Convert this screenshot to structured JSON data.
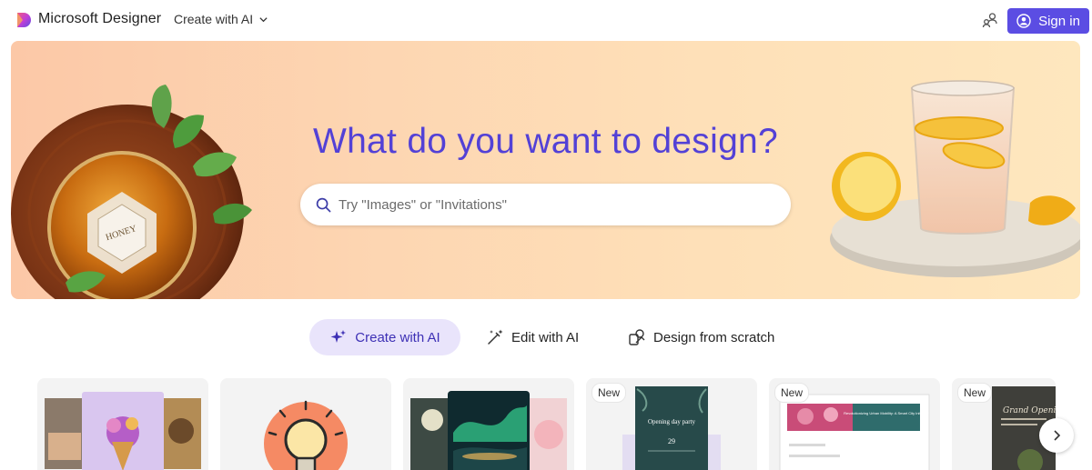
{
  "header": {
    "app_title": "Microsoft Designer",
    "create_menu_label": "Create with AI",
    "signin_label": "Sign in"
  },
  "hero": {
    "title": "What do you want to design?",
    "search_placeholder": "Try \"Images\" or \"Invitations\"",
    "jar_label": "HONEY"
  },
  "modes": {
    "create": "Create with AI",
    "edit": "Edit with AI",
    "scratch": "Design from scratch"
  },
  "cards": [
    {
      "badge": ""
    },
    {
      "badge": ""
    },
    {
      "badge": ""
    },
    {
      "badge": "New",
      "thumb_title": "Opening day party",
      "thumb_day": "29"
    },
    {
      "badge": "New",
      "thumb_title": "Revolutionizing Urban Mobility: A Smart City Initiative"
    },
    {
      "badge": "New",
      "thumb_title": "Grand Opening"
    }
  ],
  "colors": {
    "accent": "#5b4de3",
    "hero_title": "#5341d6",
    "create_tab_bg": "#e9e4fb"
  }
}
